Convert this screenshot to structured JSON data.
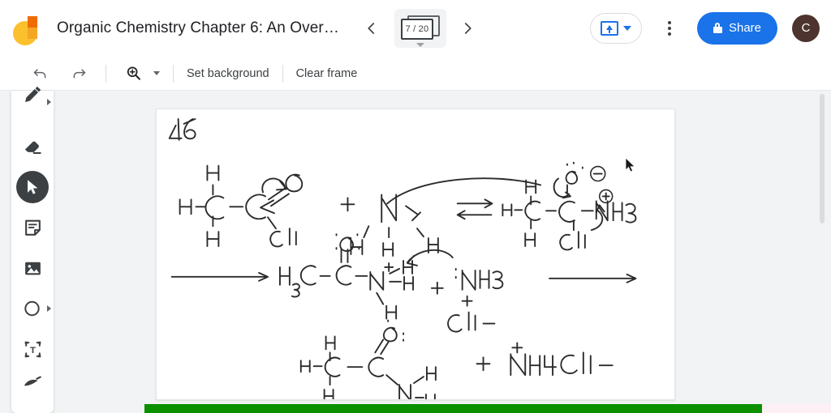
{
  "app": {
    "name": "Jamboard",
    "logo_icon": "jamboard-logo",
    "accent_blue": "#1a73e8",
    "avatar_color": "#4e342e",
    "progress_color": "#0b9000"
  },
  "header": {
    "doc_title": "Organic Chemistry Chapter 6: An Over…",
    "prev_frame_icon": "chevron-left-icon",
    "prev_frame_label": "‹",
    "next_frame_icon": "chevron-right-icon",
    "next_frame_label": "›",
    "frame_counter": "7 / 20",
    "frame_current": 7,
    "frame_total": 20,
    "frame_icon": "frame-stack-icon",
    "present_icon": "present-screen-icon",
    "present_caret_icon": "chevron-down-icon",
    "more_icon": "kebab-menu-icon",
    "share_label": "Share",
    "share_lock_icon": "lock-icon",
    "avatar_initial": "C"
  },
  "toolbar": {
    "undo_icon": "undo-arrow-icon",
    "undo_glyph": "↶",
    "redo_icon": "redo-arrow-icon",
    "redo_glyph": "↷",
    "zoom_icon": "zoom-in-magnifier-icon",
    "zoom_caret_icon": "chevron-down-icon",
    "set_background_label": "Set background",
    "clear_frame_label": "Clear frame"
  },
  "tools": {
    "items": [
      {
        "name": "pen-tool",
        "icon": "pen-icon",
        "active": false,
        "has_expander": true
      },
      {
        "name": "eraser-tool",
        "icon": "eraser-icon",
        "active": false,
        "has_expander": false
      },
      {
        "name": "select-tool",
        "icon": "cursor-arrow-icon",
        "active": true,
        "has_expander": false
      },
      {
        "name": "sticky-note-tool",
        "icon": "sticky-note-icon",
        "active": false,
        "has_expander": false
      },
      {
        "name": "image-tool",
        "icon": "image-icon",
        "active": false,
        "has_expander": false
      },
      {
        "name": "shape-tool",
        "icon": "circle-shape-icon",
        "active": false,
        "has_expander": true
      },
      {
        "name": "text-box-tool",
        "icon": "text-box-icon",
        "active": false,
        "has_expander": false
      },
      {
        "name": "laser-pointer-tool",
        "icon": "laser-pointer-icon",
        "active": false,
        "has_expander": false
      }
    ]
  },
  "canvas": {
    "frame_label": "46",
    "description": "Handwritten organic chemistry reaction mechanism: nucleophilic acyl substitution of acetyl chloride with ammonia",
    "cursor_icon": "mouse-pointer-icon",
    "scrollbar_icon": "vertical-scrollbar",
    "handwriting": {
      "row1": {
        "reactant": "H–C(H)(H)–C(=O)–Cl",
        "plus": "+",
        "nucleophile": "N(H)(H)H",
        "arrow": "equilibrium-arrow",
        "product": "H–C(H)(H)–C(O⁻)(Cl)–N⁺H₃"
      },
      "row2": {
        "arrow_in": "reaction-arrow",
        "species": "H₃C–C(=O)–N⁺H₃",
        "plus": "+",
        "base": "NH₃",
        "counterion": "Cl⁻",
        "arrow_out": "reaction-arrow"
      },
      "row3": {
        "product": "H–C(H)(H)–C(=O)–N(H)H",
        "plus": "+",
        "salt": "⁺NH₄ Cl⁻"
      }
    }
  },
  "progress": {
    "percent": 90,
    "value_label": "90"
  }
}
